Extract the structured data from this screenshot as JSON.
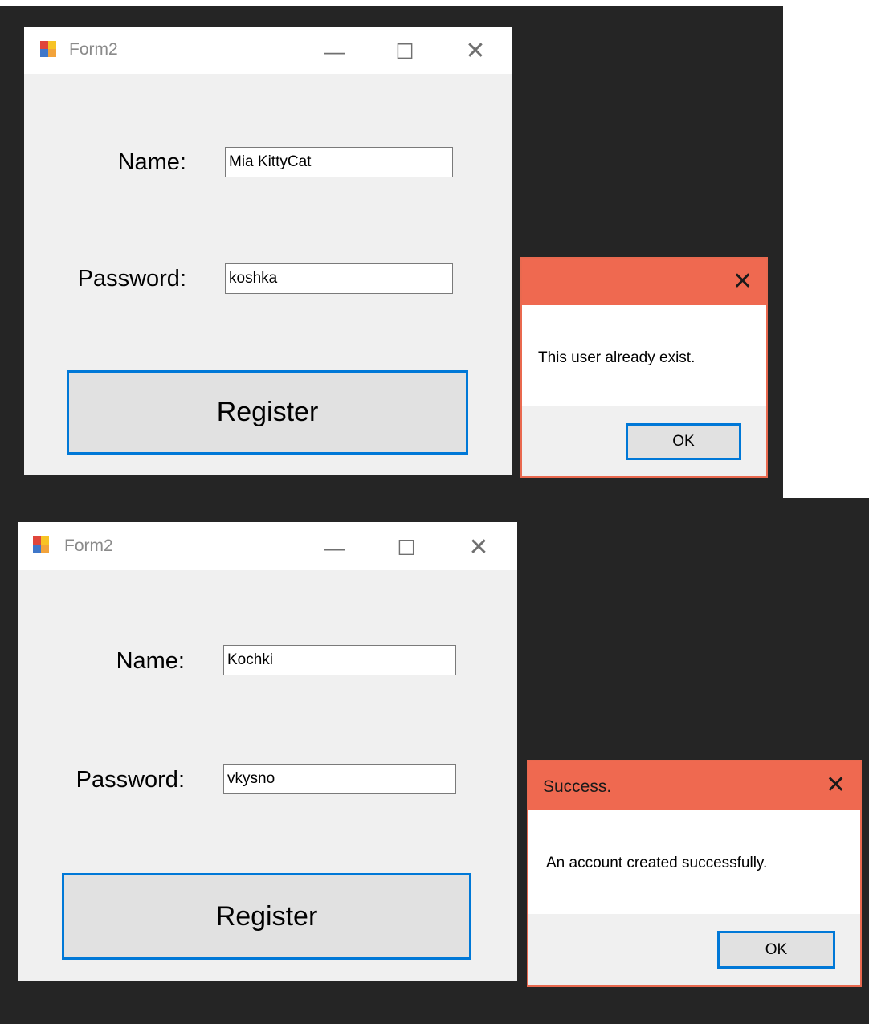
{
  "screens": [
    {
      "form": {
        "title": "Form2",
        "minimize_icon": "minimize-icon",
        "maximize_icon": "maximize-icon",
        "close_icon": "close-icon",
        "name_label": "Name:",
        "name_value": "Mia KittyCat",
        "password_label": "Password:",
        "password_value": "koshka",
        "register_label": "Register"
      },
      "messagebox": {
        "title": "",
        "message": "This user already exist.",
        "ok_label": "OK"
      }
    },
    {
      "form": {
        "title": "Form2",
        "minimize_icon": "minimize-icon",
        "maximize_icon": "maximize-icon",
        "close_icon": "close-icon",
        "name_label": "Name:",
        "name_value": "Kochki",
        "password_label": "Password:",
        "password_value": "vkysno",
        "register_label": "Register"
      },
      "messagebox": {
        "title": "Success.",
        "message": "An account created successfully.",
        "ok_label": "OK"
      }
    }
  ],
  "colors": {
    "backdrop": "#252525",
    "form_bg": "#f0f0f0",
    "focus_border": "#0078d7",
    "msgbox_titlebar": "#ef6950"
  }
}
